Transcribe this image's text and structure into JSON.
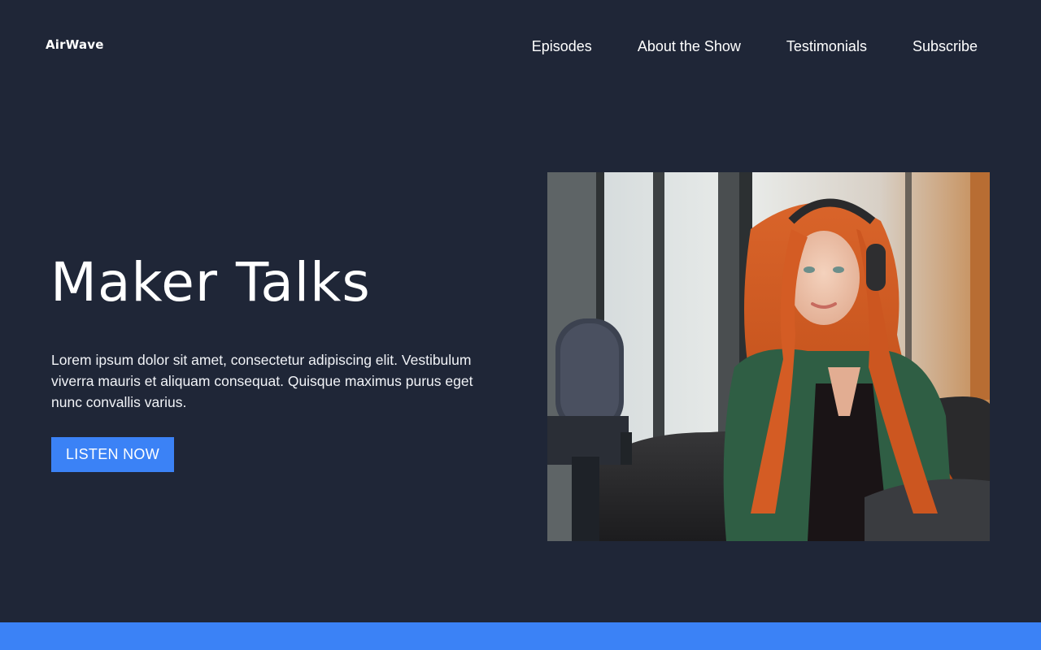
{
  "header": {
    "logo": "AirWave",
    "nav": [
      "Episodes",
      "About the Show",
      "Testimonials",
      "Subscribe"
    ]
  },
  "hero": {
    "title": "Maker Talks",
    "description": "Lorem ipsum dolor sit amet, consectetur adipiscing elit. Vestibulum viverra mauris et aliquam consequat. Quisque maximus purus eget nunc convallis varius.",
    "cta_label": "LISTEN NOW"
  },
  "colors": {
    "background": "#1f2637",
    "accent": "#3b82f6",
    "text": "#ffffff"
  }
}
